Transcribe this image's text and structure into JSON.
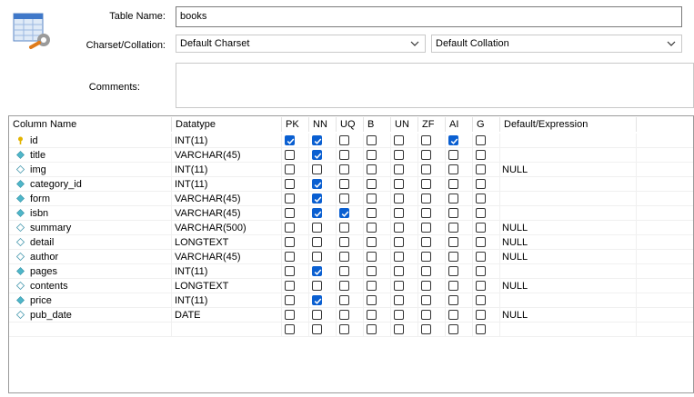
{
  "form": {
    "table_name_label": "Table Name:",
    "table_name_value": "books",
    "charset_label": "Charset/Collation:",
    "charset_value": "Default Charset",
    "collation_value": "Default Collation",
    "comments_label": "Comments:",
    "comments_value": ""
  },
  "grid": {
    "headers": [
      "Column Name",
      "Datatype",
      "PK",
      "NN",
      "UQ",
      "B",
      "UN",
      "ZF",
      "AI",
      "G",
      "Default/Expression"
    ],
    "rows": [
      {
        "name": "id",
        "type": "INT(11)",
        "icon": "key-icon",
        "flags": [
          true,
          true,
          false,
          false,
          false,
          false,
          true,
          false
        ],
        "default": ""
      },
      {
        "name": "title",
        "type": "VARCHAR(45)",
        "icon": "filled-diamond-icon",
        "flags": [
          false,
          true,
          false,
          false,
          false,
          false,
          false,
          false
        ],
        "default": ""
      },
      {
        "name": "img",
        "type": "INT(11)",
        "icon": "outline-diamond-icon",
        "flags": [
          false,
          false,
          false,
          false,
          false,
          false,
          false,
          false
        ],
        "default": "NULL"
      },
      {
        "name": "category_id",
        "type": "INT(11)",
        "icon": "filled-diamond-icon",
        "flags": [
          false,
          true,
          false,
          false,
          false,
          false,
          false,
          false
        ],
        "default": ""
      },
      {
        "name": "form",
        "type": "VARCHAR(45)",
        "icon": "filled-diamond-icon",
        "flags": [
          false,
          true,
          false,
          false,
          false,
          false,
          false,
          false
        ],
        "default": ""
      },
      {
        "name": "isbn",
        "type": "VARCHAR(45)",
        "icon": "filled-diamond-icon",
        "flags": [
          false,
          true,
          true,
          false,
          false,
          false,
          false,
          false
        ],
        "default": ""
      },
      {
        "name": "summary",
        "type": "VARCHAR(500)",
        "icon": "outline-diamond-icon",
        "flags": [
          false,
          false,
          false,
          false,
          false,
          false,
          false,
          false
        ],
        "default": "NULL"
      },
      {
        "name": "detail",
        "type": "LONGTEXT",
        "icon": "outline-diamond-icon",
        "flags": [
          false,
          false,
          false,
          false,
          false,
          false,
          false,
          false
        ],
        "default": "NULL"
      },
      {
        "name": "author",
        "type": "VARCHAR(45)",
        "icon": "outline-diamond-icon",
        "flags": [
          false,
          false,
          false,
          false,
          false,
          false,
          false,
          false
        ],
        "default": "NULL"
      },
      {
        "name": "pages",
        "type": "INT(11)",
        "icon": "filled-diamond-icon",
        "flags": [
          false,
          true,
          false,
          false,
          false,
          false,
          false,
          false
        ],
        "default": ""
      },
      {
        "name": "contents",
        "type": "LONGTEXT",
        "icon": "outline-diamond-icon",
        "flags": [
          false,
          false,
          false,
          false,
          false,
          false,
          false,
          false
        ],
        "default": "NULL"
      },
      {
        "name": "price",
        "type": "INT(11)",
        "icon": "filled-diamond-icon",
        "flags": [
          false,
          true,
          false,
          false,
          false,
          false,
          false,
          false
        ],
        "default": ""
      },
      {
        "name": "pub_date",
        "type": "DATE",
        "icon": "outline-diamond-icon",
        "flags": [
          false,
          false,
          false,
          false,
          false,
          false,
          false,
          false
        ],
        "default": "NULL"
      },
      {
        "name": "",
        "type": "",
        "icon": "",
        "flags": [
          false,
          false,
          false,
          false,
          false,
          false,
          false,
          false
        ],
        "default": ""
      }
    ]
  },
  "colors": {
    "checked": "#0a5fd1",
    "diamond": "#4fb6c9",
    "key": "#e3b400"
  }
}
